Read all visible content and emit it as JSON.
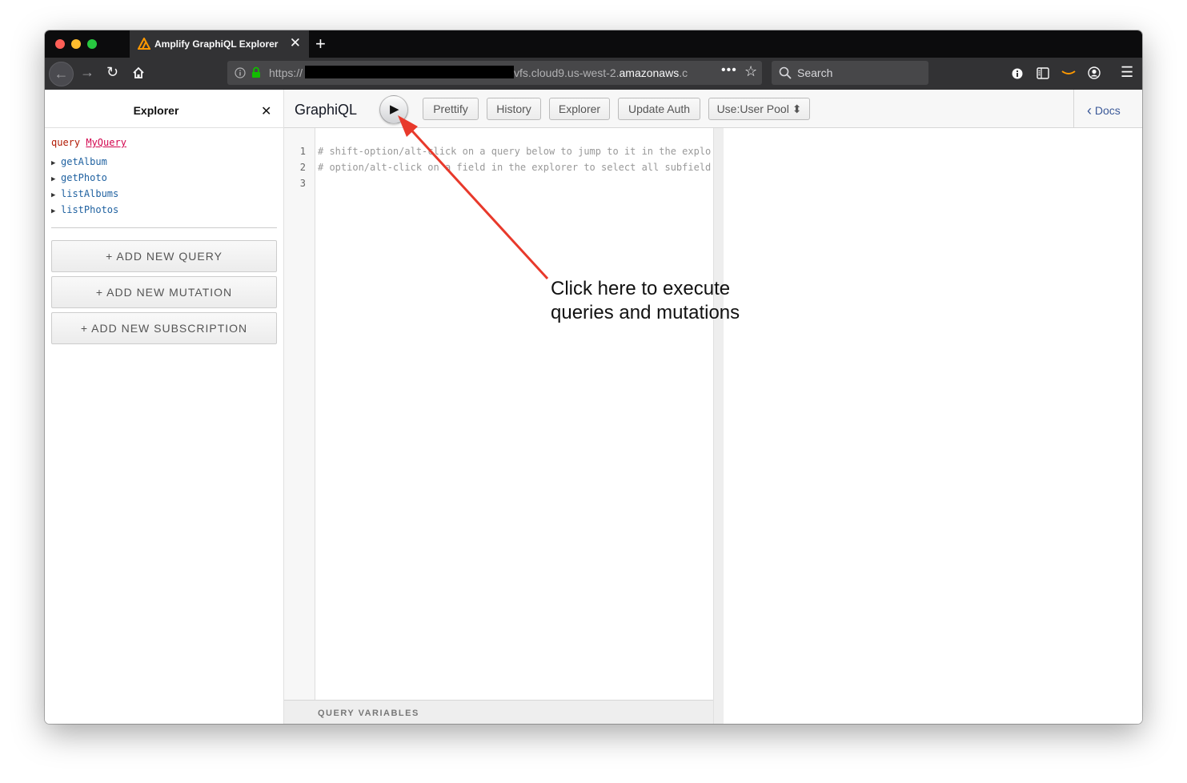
{
  "browser": {
    "tab_title": "Amplify GraphiQL Explorer",
    "new_tab_icon": "+",
    "url_prefix": "https://",
    "url_host_part": "vfs.cloud9.us-west-2.",
    "url_host_bold": "amazonaws",
    "url_tail": ".c",
    "search_placeholder": "Search"
  },
  "explorer": {
    "title": "Explorer",
    "query_keyword": "query",
    "query_name": "MyQuery",
    "fields": [
      "getAlbum",
      "getPhoto",
      "listAlbums",
      "listPhotos"
    ],
    "buttons": [
      "+ ADD NEW QUERY",
      "+ ADD NEW MUTATION",
      "+ ADD NEW SUBSCRIPTION"
    ]
  },
  "graphiql": {
    "title": "GraphiQL",
    "toolbar": [
      "Prettify",
      "History",
      "Explorer",
      "Update Auth",
      "Use:User Pool ⬍"
    ],
    "docs_label": "Docs",
    "editor_lines": [
      {
        "n": "1",
        "text": "# shift-option/alt-click on a query below to jump to it in the explorer"
      },
      {
        "n": "2",
        "text": "# option/alt-click on a field in the explorer to select all subfields"
      },
      {
        "n": "3",
        "text": ""
      }
    ],
    "variables_label": "QUERY VARIABLES"
  },
  "annotation": {
    "line1": "Click here to execute",
    "line2": "queries and mutations",
    "arrow_color": "#e8392b"
  },
  "colors": {
    "tab_bar": "#0c0c0d",
    "nav_bar": "#323234",
    "keyword": "#B11A04",
    "field": "#1F61A0"
  }
}
